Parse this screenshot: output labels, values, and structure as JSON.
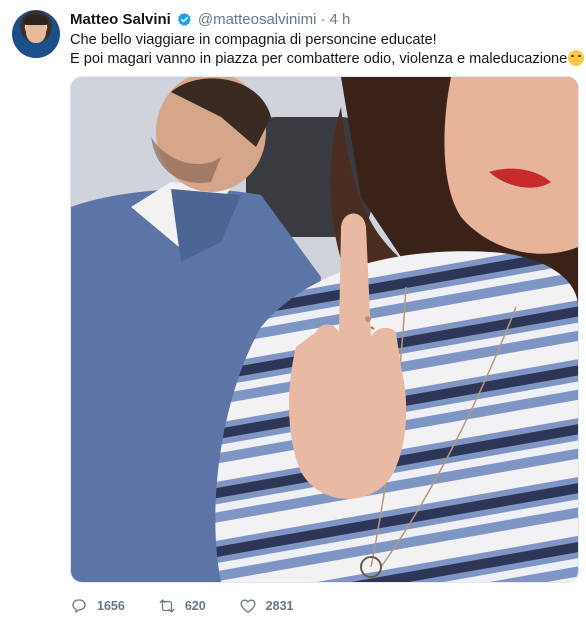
{
  "tweet": {
    "author_name": "Matteo Salvini",
    "handle": "@matteosalvinimi",
    "separator": "·",
    "time": "4 h",
    "text_line1": "Che bello viaggiare in compagnia di personcine educate!",
    "text_line2": "E poi magari vanno in piazza per combattere odio, violenza e maleducazione",
    "emoji": "face-with-tears-of-joy-icon"
  },
  "actions": {
    "replies": "1656",
    "retweets": "620",
    "likes": "2831"
  },
  "colors": {
    "verified": "#1da1f2",
    "secondary_text": "#657786",
    "primary_text": "#14171a"
  }
}
